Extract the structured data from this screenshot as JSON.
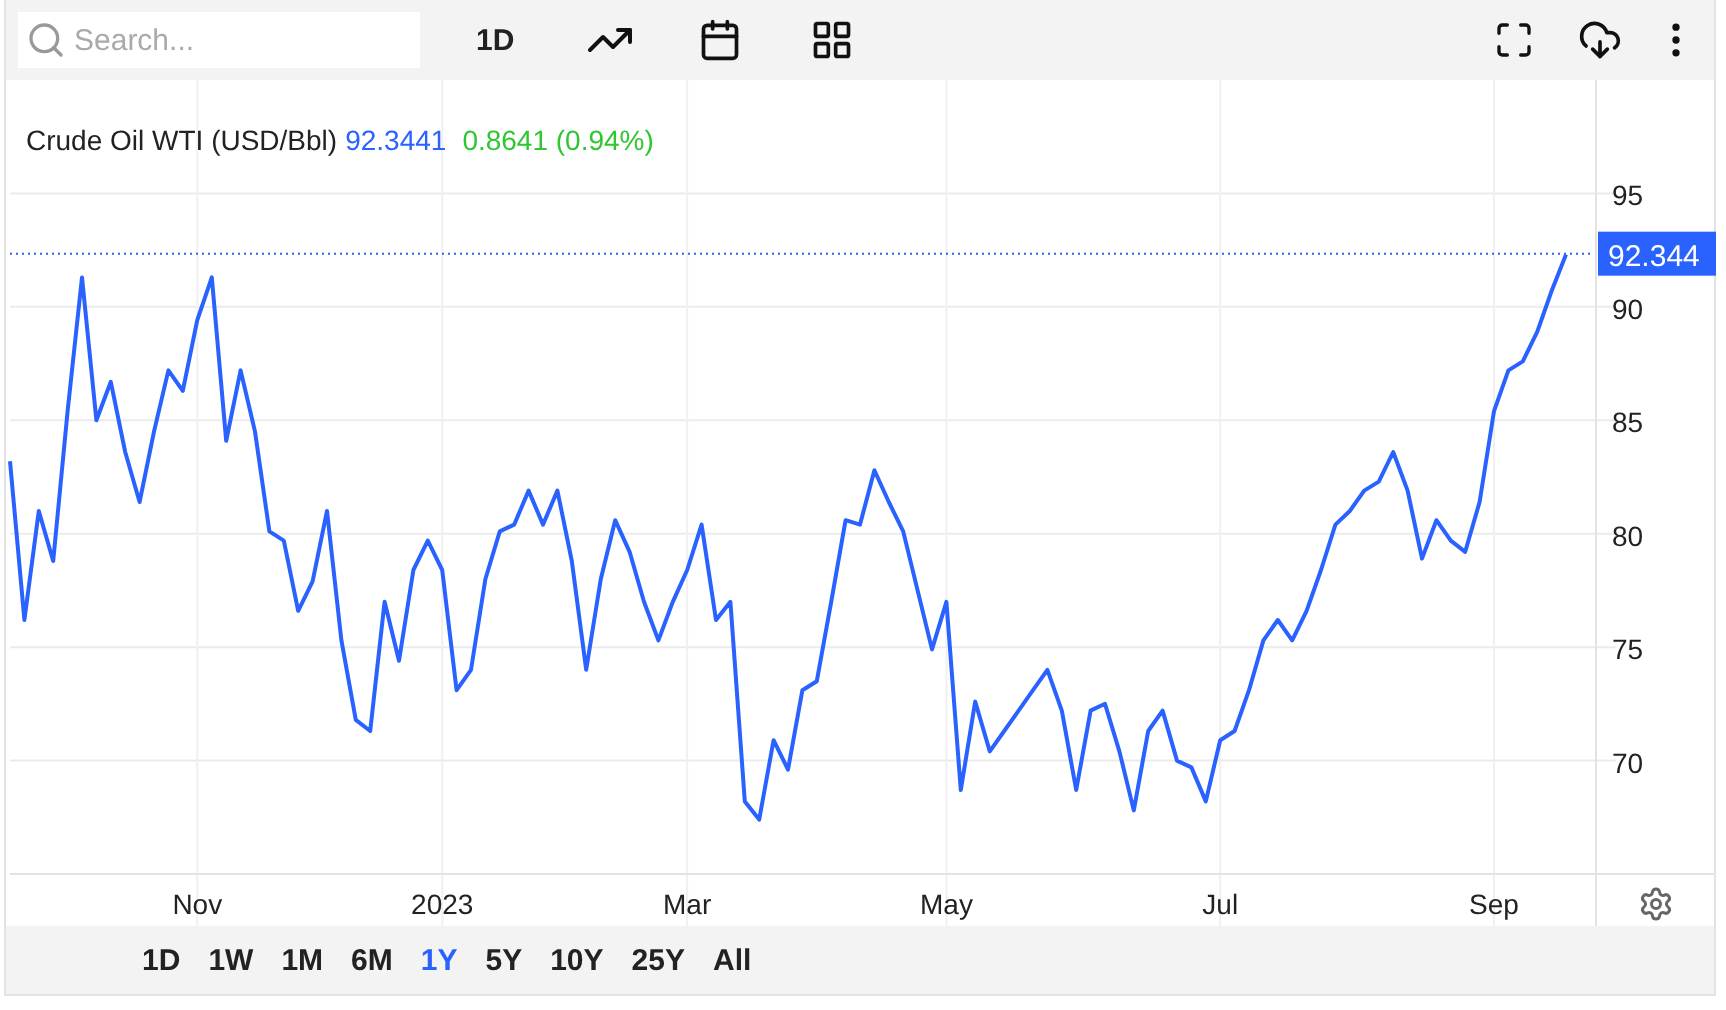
{
  "toolbar": {
    "search": {
      "placeholder": "Search..."
    },
    "interval": "1D"
  },
  "legend": {
    "price": "92.3441",
    "change": "0.8641 (0.94%)"
  },
  "chart": {
    "chart_data": {
      "type": "line",
      "ylim": [
        65,
        100
      ],
      "grid": true,
      "ref_lines": [
        {
          "axis": "y",
          "value": 92.344,
          "label": "92.344"
        }
      ],
      "yticks": [
        70,
        75,
        80,
        85,
        90,
        95
      ],
      "categories": [
        null,
        null,
        null,
        null,
        null,
        null,
        null,
        null,
        null,
        null,
        null,
        null,
        null,
        "Nov",
        null,
        null,
        null,
        null,
        null,
        null,
        null,
        null,
        null,
        null,
        null,
        null,
        null,
        null,
        null,
        null,
        "2023",
        null,
        null,
        null,
        null,
        null,
        null,
        null,
        null,
        null,
        null,
        null,
        null,
        null,
        null,
        null,
        null,
        "Mar",
        null,
        null,
        null,
        null,
        null,
        null,
        null,
        null,
        null,
        null,
        null,
        null,
        null,
        null,
        null,
        null,
        null,
        "May",
        null,
        null,
        null,
        null,
        null,
        null,
        null,
        null,
        null,
        null,
        null,
        null,
        null,
        null,
        null,
        null,
        null,
        null,
        "Jul",
        null,
        null,
        null,
        null,
        null,
        null,
        null,
        null,
        null,
        null,
        null,
        null,
        null,
        null,
        null,
        null,
        null,
        null,
        "Sep",
        null,
        null,
        null,
        null,
        null
      ],
      "series": [
        {
          "name": "Crude Oil WTI (USD/Bbl)",
          "color": "#2962ff",
          "values": [
            83.2,
            76.2,
            81,
            78.8,
            85.4,
            91.3,
            85,
            86.7,
            83.6,
            81.4,
            84.5,
            87.2,
            86.3,
            89.4,
            91.3,
            84.1,
            87.2,
            84.5,
            80.1,
            79.7,
            76.6,
            77.9,
            81,
            75.3,
            71.8,
            71.3,
            77,
            74.4,
            78.4,
            79.7,
            78.4,
            73.1,
            74,
            78,
            80.1,
            80.4,
            81.9,
            80.4,
            81.9,
            78.8,
            74,
            78,
            80.6,
            79.2,
            77,
            75.3,
            77,
            78.4,
            80.4,
            76.2,
            77,
            68.2,
            67.4,
            70.9,
            69.6,
            73.1,
            73.5,
            77,
            80.6,
            80.4,
            82.8,
            81.4,
            80.1,
            77.5,
            74.9,
            77,
            68.7,
            72.6,
            70.4,
            71.3,
            72.2,
            73.1,
            74,
            72.2,
            68.7,
            72.2,
            72.5,
            70.4,
            67.8,
            71.3,
            72.2,
            70,
            69.7,
            68.2,
            70.9,
            71.3,
            73.1,
            75.3,
            76.2,
            75.3,
            76.6,
            78.4,
            80.4,
            81,
            81.9,
            82.3,
            83.6,
            81.9,
            78.9,
            80.6,
            79.7,
            79.2,
            81.4,
            85.4,
            87.2,
            87.6,
            88.9,
            90.7,
            92.3
          ]
        }
      ]
    }
  },
  "ranges": [
    {
      "label": "1D",
      "selected": false
    },
    {
      "label": "1W",
      "selected": false
    },
    {
      "label": "1M",
      "selected": false
    },
    {
      "label": "6M",
      "selected": false
    },
    {
      "label": "1Y",
      "selected": true
    },
    {
      "label": "5Y",
      "selected": false
    },
    {
      "label": "10Y",
      "selected": false
    },
    {
      "label": "25Y",
      "selected": false
    },
    {
      "label": "All",
      "selected": false
    }
  ]
}
